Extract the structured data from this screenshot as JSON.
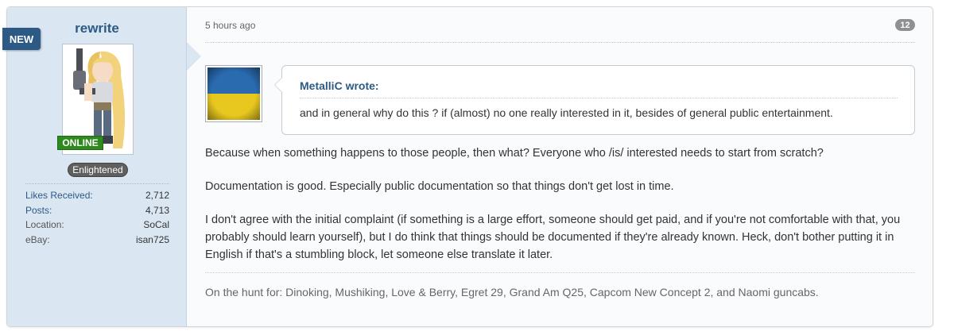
{
  "user": {
    "new_badge": "NEW",
    "name": "rewrite",
    "online_badge": "ONLINE",
    "rank": "Enlightened",
    "stats": [
      {
        "label": "Likes Received:",
        "value": "2,712"
      },
      {
        "label": "Posts:",
        "value": "4,713"
      },
      {
        "label": "Location:",
        "value": "SoCal"
      },
      {
        "label": "eBay:",
        "value": "isan725"
      }
    ]
  },
  "post": {
    "timestamp": "5 hours ago",
    "number": "12",
    "quote": {
      "author": "MetalliC wrote:",
      "text": "and in general why do this ? if (almost) no one really interested in it, besides of general public entertainment."
    },
    "paragraphs": [
      "Because when something happens to those people, then what? Everyone who /is/ interested needs to start from scratch?",
      "Documentation is good. Especially public documentation so that things don't get lost in time.",
      "I don't agree with the initial complaint (if something is a large effort, someone should get paid, and if you're not comfortable with that, you probably should learn yourself), but I do think that things should be documented if they're already known. Heck, don't bother putting it in English if that's a stumbling block, let someone else translate it later."
    ],
    "signature": "On the hunt for: Dinoking, Mushiking, Love & Berry, Egret 29, Grand Am Q25, Capcom New Concept 2, and Naomi guncabs."
  },
  "colors": {
    "sidebar_bg": "#dbe6f3",
    "link": "#2d5a85",
    "new_badge": "#2d5a85",
    "online": "#2e8a1f",
    "rank": "#5f5f5f"
  },
  "icons": {
    "avatar": "anime-character-avatar",
    "quote_avatar": "ukraine-flag-avatar"
  }
}
